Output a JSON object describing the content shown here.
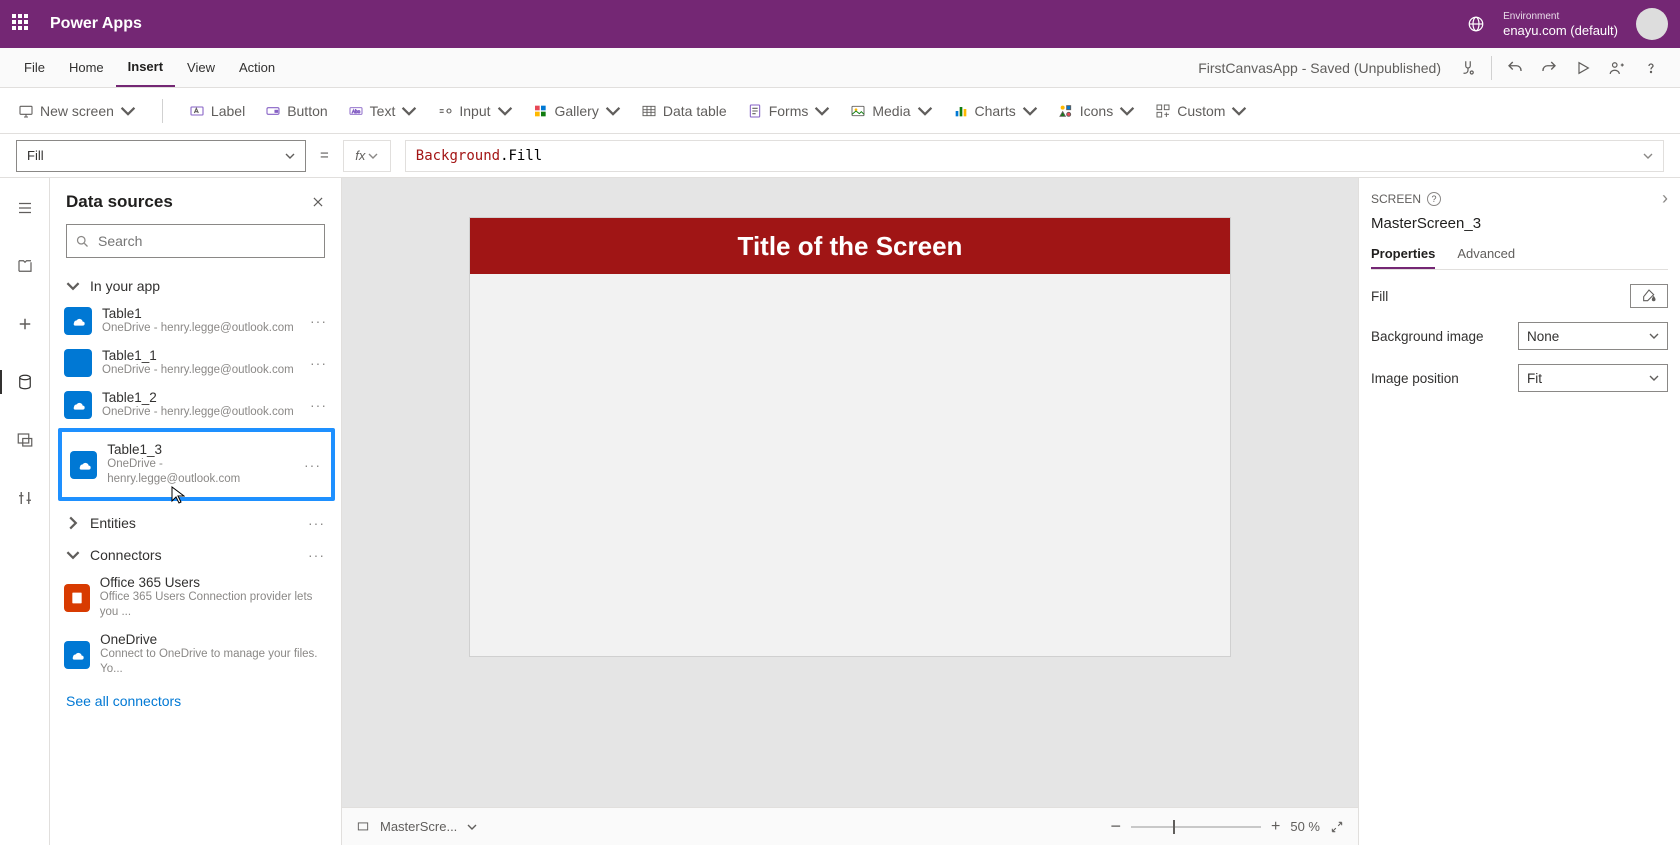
{
  "brand": {
    "title": "Power Apps",
    "env_label": "Environment",
    "env_name": "enayu.com (default)"
  },
  "menu": {
    "items": [
      "File",
      "Home",
      "Insert",
      "View",
      "Action"
    ],
    "active": "Insert",
    "status": "FirstCanvasApp - Saved (Unpublished)"
  },
  "ribbon": {
    "new_screen": "New screen",
    "label": "Label",
    "button": "Button",
    "text": "Text",
    "input": "Input",
    "gallery": "Gallery",
    "data_table": "Data table",
    "forms": "Forms",
    "media": "Media",
    "charts": "Charts",
    "icons": "Icons",
    "custom": "Custom"
  },
  "formula": {
    "property": "Fill",
    "fx": "fx",
    "expr_obj": "Background",
    "expr_prop": ".Fill"
  },
  "left": {
    "title": "Data sources",
    "search_placeholder": "Search",
    "sec_in_app": "In your app",
    "sec_entities": "Entities",
    "sec_connectors": "Connectors",
    "items": [
      {
        "name": "Table1",
        "sub": "OneDrive - henry.legge@outlook.com"
      },
      {
        "name": "Table1_1",
        "sub": "OneDrive - henry.legge@outlook.com"
      },
      {
        "name": "Table1_2",
        "sub": "OneDrive - henry.legge@outlook.com"
      },
      {
        "name": "Table1_3",
        "sub": "OneDrive - henry.legge@outlook.com"
      }
    ],
    "connectors": [
      {
        "name": "Office 365 Users",
        "sub": "Office 365 Users Connection provider lets you ..."
      },
      {
        "name": "OneDrive",
        "sub": "Connect to OneDrive to manage your files. Yo..."
      }
    ],
    "see_all": "See all connectors"
  },
  "canvas": {
    "screen_title": "Title of the Screen",
    "breadcrumb": "MasterScre...",
    "zoom": "50  %"
  },
  "right": {
    "header": "SCREEN",
    "name": "MasterScreen_3",
    "tabs": {
      "properties": "Properties",
      "advanced": "Advanced"
    },
    "props": {
      "fill_label": "Fill",
      "bg_image_label": "Background image",
      "bg_image_value": "None",
      "img_pos_label": "Image position",
      "img_pos_value": "Fit"
    }
  }
}
